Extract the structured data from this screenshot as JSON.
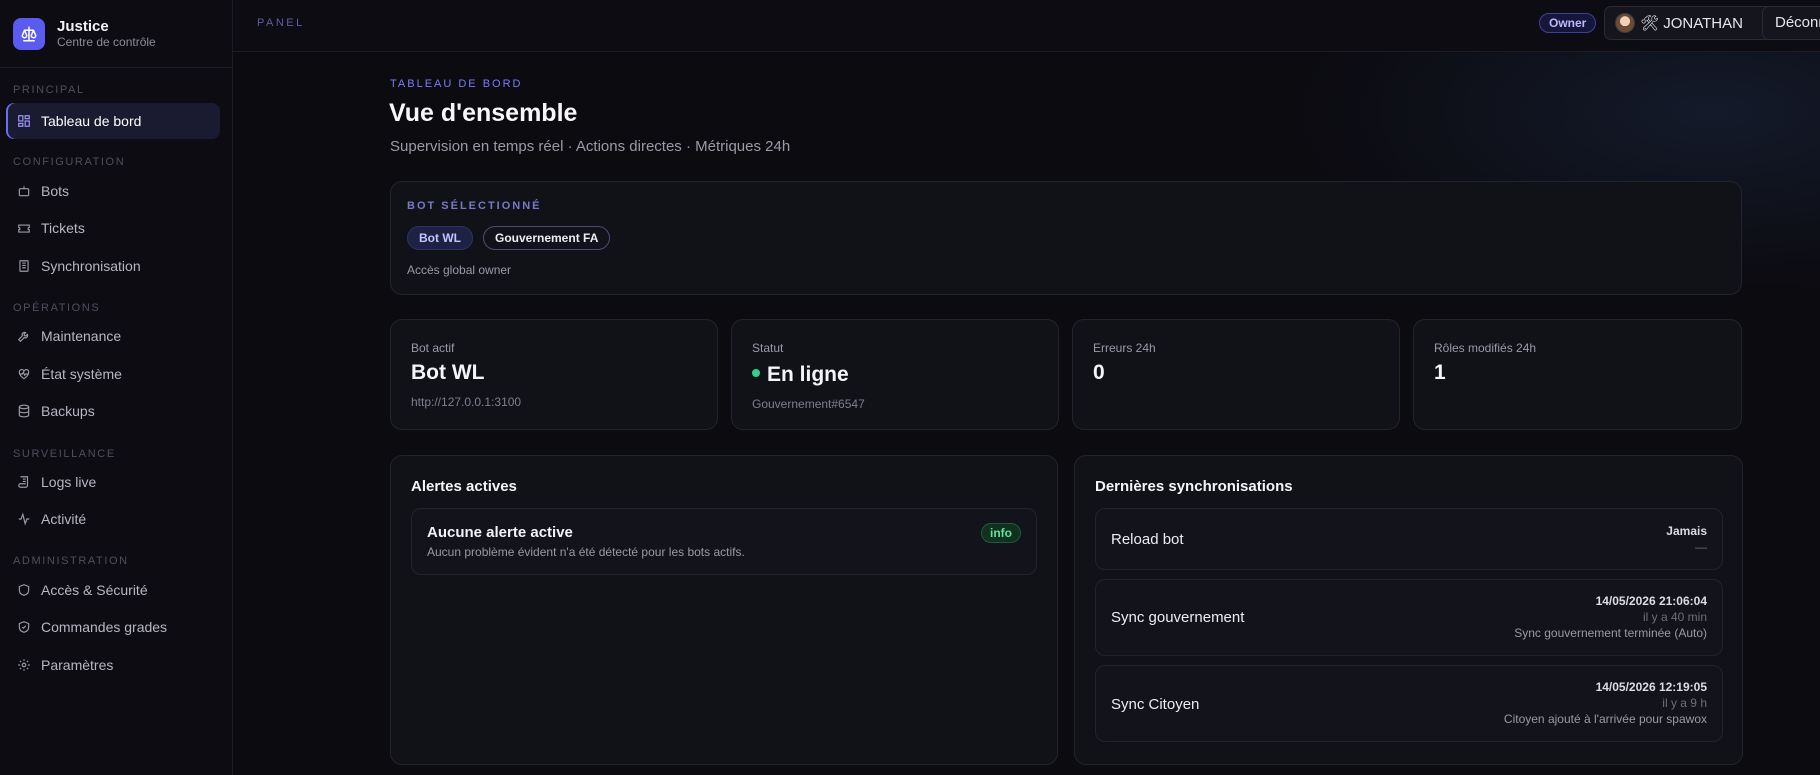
{
  "brand": {
    "title": "Justice",
    "subtitle": "Centre de contrôle"
  },
  "sidebar": {
    "sections": [
      {
        "label": "PRINCIPAL"
      },
      {
        "label": "CONFIGURATION"
      },
      {
        "label": "OPÉRATIONS"
      },
      {
        "label": "SURVEILLANCE"
      },
      {
        "label": "ADMINISTRATION"
      }
    ],
    "items": [
      {
        "label": "Tableau de bord",
        "icon": "dashboard-icon",
        "active": true
      },
      {
        "label": "Bots",
        "icon": "bot-icon"
      },
      {
        "label": "Tickets",
        "icon": "ticket-icon"
      },
      {
        "label": "Synchronisation",
        "icon": "sync-icon"
      },
      {
        "label": "Maintenance",
        "icon": "wrench-icon"
      },
      {
        "label": "État système",
        "icon": "heart-pulse-icon"
      },
      {
        "label": "Backups",
        "icon": "database-icon"
      },
      {
        "label": "Logs live",
        "icon": "scroll-icon"
      },
      {
        "label": "Activité",
        "icon": "activity-icon"
      },
      {
        "label": "Accès & Sécurité",
        "icon": "shield-icon"
      },
      {
        "label": "Commandes grades",
        "icon": "shield-check-icon"
      },
      {
        "label": "Paramètres",
        "icon": "gear-icon"
      }
    ]
  },
  "topbar": {
    "label": "PANEL",
    "role_badge": "Owner",
    "user_name": "🛠 JONATHAN",
    "logout_label": "Déconnexion"
  },
  "page": {
    "eyebrow": "TABLEAU DE BORD",
    "title": "Vue d'ensemble",
    "subtitle": "Supervision en temps réel · Actions directes · Métriques 24h"
  },
  "selected_bot": {
    "label": "BOT SÉLECTIONNÉ",
    "pills": [
      "Bot WL",
      "Gouvernement FA"
    ],
    "note": "Accès global owner"
  },
  "stats": [
    {
      "label": "Bot actif",
      "value": "Bot WL",
      "sub": "http://127.0.0.1:3100"
    },
    {
      "label": "Statut",
      "value": "En ligne",
      "sub": "Gouvernement#6547",
      "status_color": "#2fd18c"
    },
    {
      "label": "Erreurs 24h",
      "value": "0",
      "sub": ""
    },
    {
      "label": "Rôles modifiés 24h",
      "value": "1",
      "sub": ""
    }
  ],
  "alerts": {
    "title": "Alertes actives",
    "items": [
      {
        "title": "Aucune alerte active",
        "desc": "Aucun problème évident n'a été détecté pour les bots actifs.",
        "badge": "info"
      }
    ]
  },
  "syncs": {
    "title": "Dernières synchronisations",
    "items": [
      {
        "name": "Reload bot",
        "date": "Jamais",
        "ago": "—",
        "note": ""
      },
      {
        "name": "Sync gouvernement",
        "date": "14/05/2026 21:06:04",
        "ago": "il y a 40 min",
        "note": "Sync gouvernement terminée (Auto)"
      },
      {
        "name": "Sync Citoyen",
        "date": "14/05/2026 12:19:05",
        "ago": "il y a 9 h",
        "note": "Citoyen ajouté à l'arrivée pour spawox"
      }
    ]
  }
}
